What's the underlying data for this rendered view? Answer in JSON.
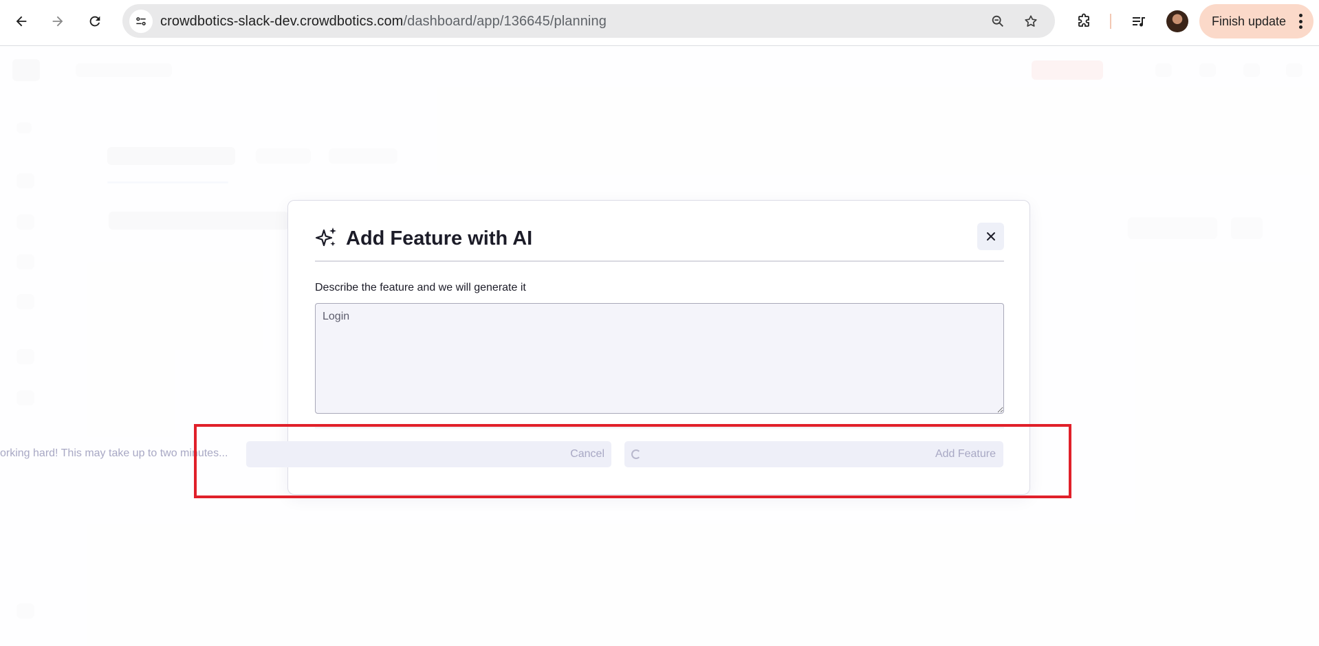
{
  "browser": {
    "url_host": "crowdbotics-slack-dev.crowdbotics.com",
    "url_path": "/dashboard/app/136645/planning",
    "update_button_label": "Finish update",
    "icons": {
      "back": "back-arrow-icon",
      "forward": "forward-arrow-icon",
      "reload": "reload-icon",
      "site_info": "site-settings-icon",
      "zoom": "zoom-out-icon",
      "bookmark": "star-icon",
      "extensions": "puzzle-icon",
      "media": "media-queue-icon",
      "profile": "avatar",
      "menu": "kebab-menu-icon"
    },
    "accent_colors": {
      "update_button": "#fbd9c9"
    }
  },
  "modal": {
    "title": "Add Feature with AI",
    "title_icon": "sparkle-icon",
    "close_icon": "close-icon",
    "field_label": "Describe the feature and we will generate it",
    "textarea_value": "Login",
    "status_text": "orking hard! This may take up to two minutes...",
    "cancel_label": "Cancel",
    "submit_label": "Add Feature",
    "submit_loading": true
  },
  "annotation": {
    "highlight_color": "#e0202a"
  }
}
